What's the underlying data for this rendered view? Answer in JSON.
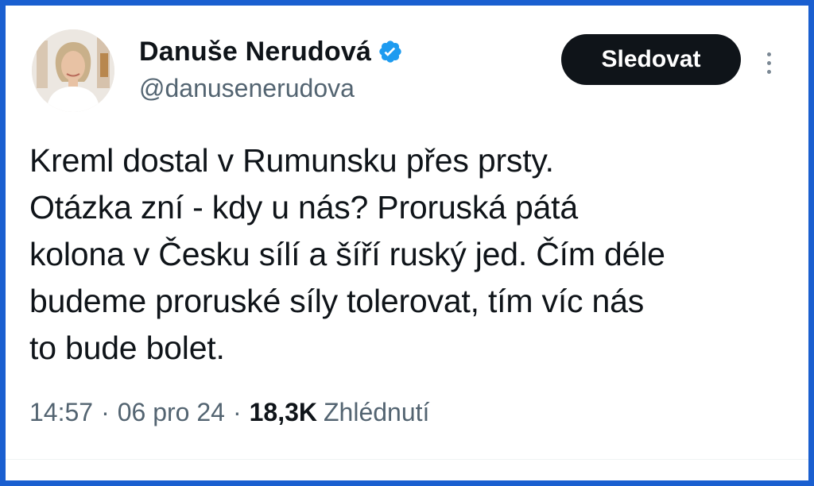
{
  "author": {
    "display_name": "Danuše Nerudová",
    "handle": "@danusenerudova",
    "verified": true,
    "avatar_icon": "profile-photo"
  },
  "actions": {
    "follow_label": "Sledovat",
    "more_icon": "more-vertical-icon"
  },
  "tweet": {
    "text": "Kreml dostal v Rumunsku přes prsty.\nOtázka zní - kdy u nás? Proruská pátá\nkolona v Česku sílí a šíří ruský jed. Čím déle\nbudeme proruské síly tolerovat, tím víc nás\nto bude bolet."
  },
  "meta": {
    "time": "14:57",
    "separator_1": "·",
    "date": "06 pro 24",
    "separator_2": "·",
    "views_count": "18,3K",
    "views_label": "Zhlédnutí"
  },
  "colors": {
    "frame_border": "#1a5fd0",
    "verified_badge": "#1d9bf0",
    "follow_button_bg": "#0f1419",
    "secondary_text": "#536471"
  }
}
